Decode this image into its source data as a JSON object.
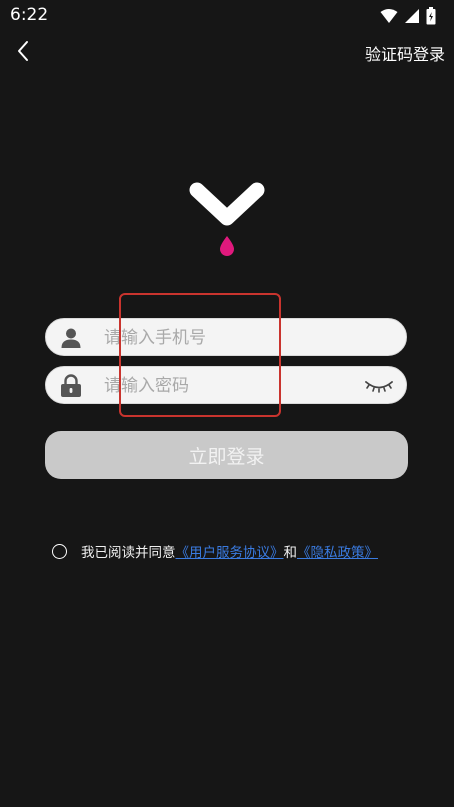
{
  "status_bar": {
    "time": "6:22"
  },
  "top_bar": {
    "sms_login": "验证码登录"
  },
  "form": {
    "phone_placeholder": "请输入手机号",
    "password_placeholder": "请输入密码",
    "login_button": "立即登录"
  },
  "agreement": {
    "prefix": "我已阅读并同意",
    "user_agreement": "《用户服务协议》",
    "connector": "和",
    "privacy_policy": "《隐私政策》"
  },
  "colors": {
    "background": "#161616",
    "logo_drop": "#e0197d",
    "highlight_box": "#c9342e",
    "link": "#3a7be0",
    "button_disabled": "#c9c9c9"
  },
  "icons": [
    "wifi-icon",
    "signal-icon",
    "battery-icon",
    "back-arrow-icon",
    "user-icon",
    "lock-icon",
    "eye-closed-icon",
    "app-logo"
  ]
}
